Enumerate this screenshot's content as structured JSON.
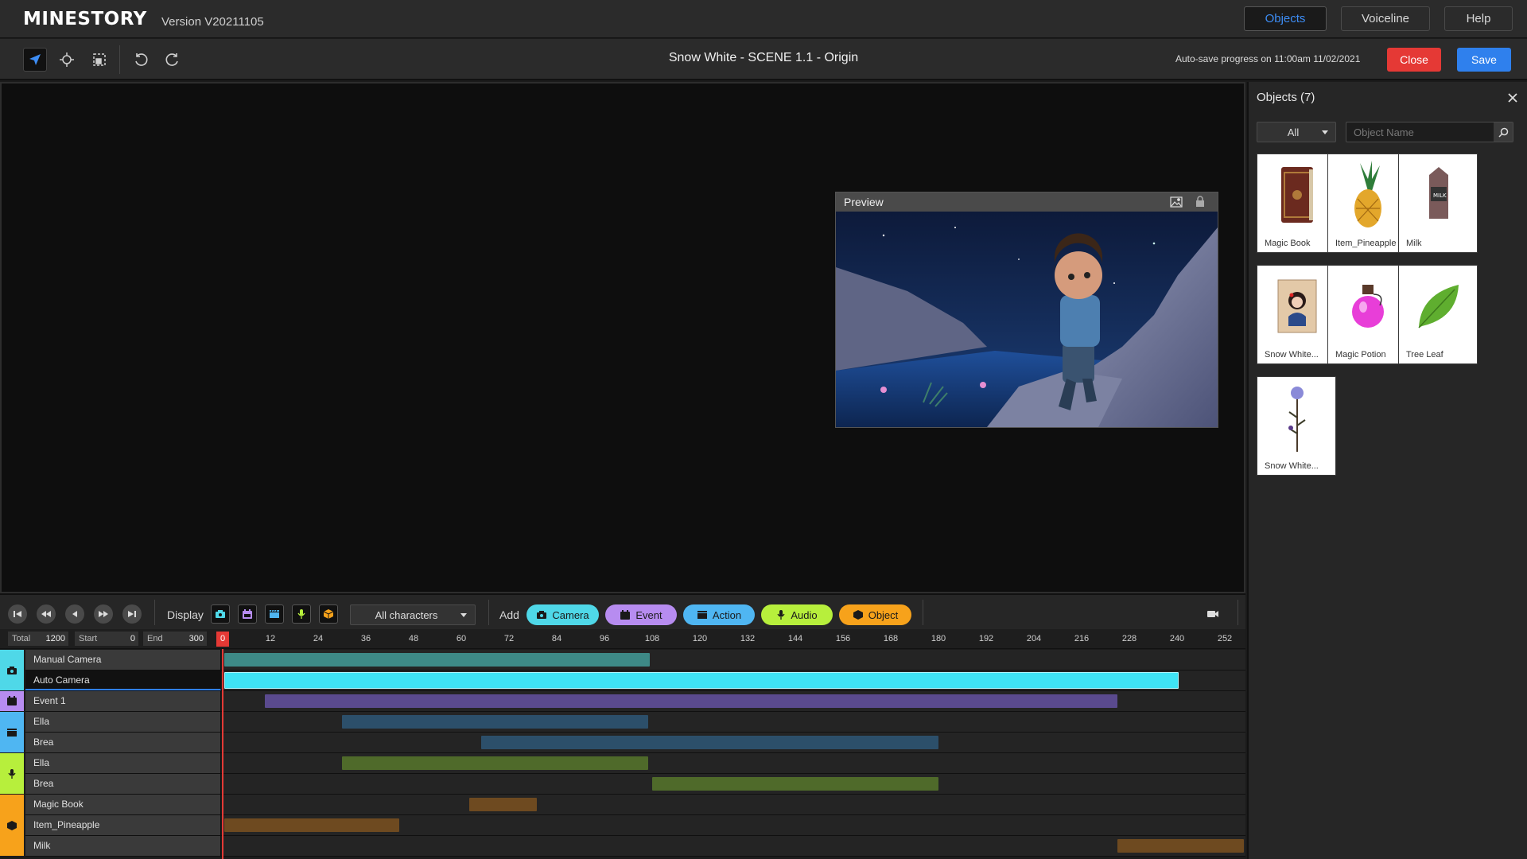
{
  "app": {
    "logo": "MINESTORY",
    "version": "Version V20211105",
    "nav": [
      {
        "label": "Objects",
        "active": true
      },
      {
        "label": "Voiceline",
        "active": false
      },
      {
        "label": "Help",
        "active": false
      }
    ]
  },
  "toolbar": {
    "tools": [
      "select-arrow-icon",
      "move-crosshair-icon",
      "frame-select-icon",
      "undo-icon",
      "redo-icon"
    ],
    "scene_title": "Snow White - SCENE 1.1 - Origin",
    "autosave": "Auto-save progress on 11:00am 11/02/2021",
    "close_label": "Close",
    "save_label": "Save"
  },
  "preview": {
    "title": "Preview",
    "icons": [
      "image-icon",
      "lock-icon"
    ]
  },
  "objects_panel": {
    "title": "Objects (7)",
    "filter": "All",
    "search_placeholder": "Object Name",
    "items": [
      {
        "label": "Magic Book"
      },
      {
        "label": "Item_Pineapple"
      },
      {
        "label": "Milk"
      },
      {
        "label": "Snow White..."
      },
      {
        "label": "Magic Potion"
      },
      {
        "label": "Tree Leaf"
      },
      {
        "label": "Snow White..."
      }
    ]
  },
  "transport": {
    "display_label": "Display",
    "characters_filter": "All characters",
    "add_label": "Add",
    "add_buttons": [
      {
        "label": "Camera",
        "color": "#4fd8e8"
      },
      {
        "label": "Event",
        "color": "#b78cf0"
      },
      {
        "label": "Action",
        "color": "#4fb6f2"
      },
      {
        "label": "Audio",
        "color": "#b7ef3c"
      },
      {
        "label": "Object",
        "color": "#f7a21b"
      }
    ]
  },
  "ruler": {
    "total_label": "Total",
    "total_value": "1200",
    "start_label": "Start",
    "start_value": "0",
    "end_label": "End",
    "end_value": "300",
    "playhead": "0",
    "ticks": [
      "12",
      "24",
      "36",
      "48",
      "60",
      "72",
      "84",
      "96",
      "108",
      "120",
      "132",
      "144",
      "156",
      "168",
      "180",
      "192",
      "204",
      "216",
      "228",
      "240",
      "252"
    ]
  },
  "timeline": {
    "categories": [
      {
        "name": "camera",
        "color": "#4fd8e8",
        "rows": 2
      },
      {
        "name": "event",
        "color": "#b78cf0",
        "rows": 1
      },
      {
        "name": "action",
        "color": "#4fb6f2",
        "rows": 2
      },
      {
        "name": "audio",
        "color": "#b7ef3c",
        "rows": 2
      },
      {
        "name": "object",
        "color": "#f7a21b",
        "rows": 3
      }
    ],
    "tracks": [
      {
        "name": "Manual Camera",
        "start": 0,
        "end": 107,
        "color": "#3e8a87"
      },
      {
        "name": "Auto Camera",
        "start": 0,
        "end": 240,
        "color": "#3fe3f5",
        "selected": true
      },
      {
        "name": "Event 1",
        "start": 10.5,
        "end": 225,
        "color": "#5a4a8e"
      },
      {
        "name": "Ella",
        "start": 30,
        "end": 107,
        "color": "#2c4f6a"
      },
      {
        "name": "Brea",
        "start": 65,
        "end": 180,
        "color": "#2c4f6a"
      },
      {
        "name": "Ella",
        "start": 30,
        "end": 107,
        "color": "#4f6a2a"
      },
      {
        "name": "Brea",
        "start": 108,
        "end": 180,
        "color": "#4f6a2a"
      },
      {
        "name": "Magic Book",
        "start": 62,
        "end": 79,
        "color": "#6e4a20"
      },
      {
        "name": "Item_Pineapple",
        "start": 0,
        "end": 44,
        "color": "#6e4a20"
      },
      {
        "name": "Milk",
        "start": 225,
        "end": 257,
        "color": "#6e4a20"
      }
    ]
  }
}
